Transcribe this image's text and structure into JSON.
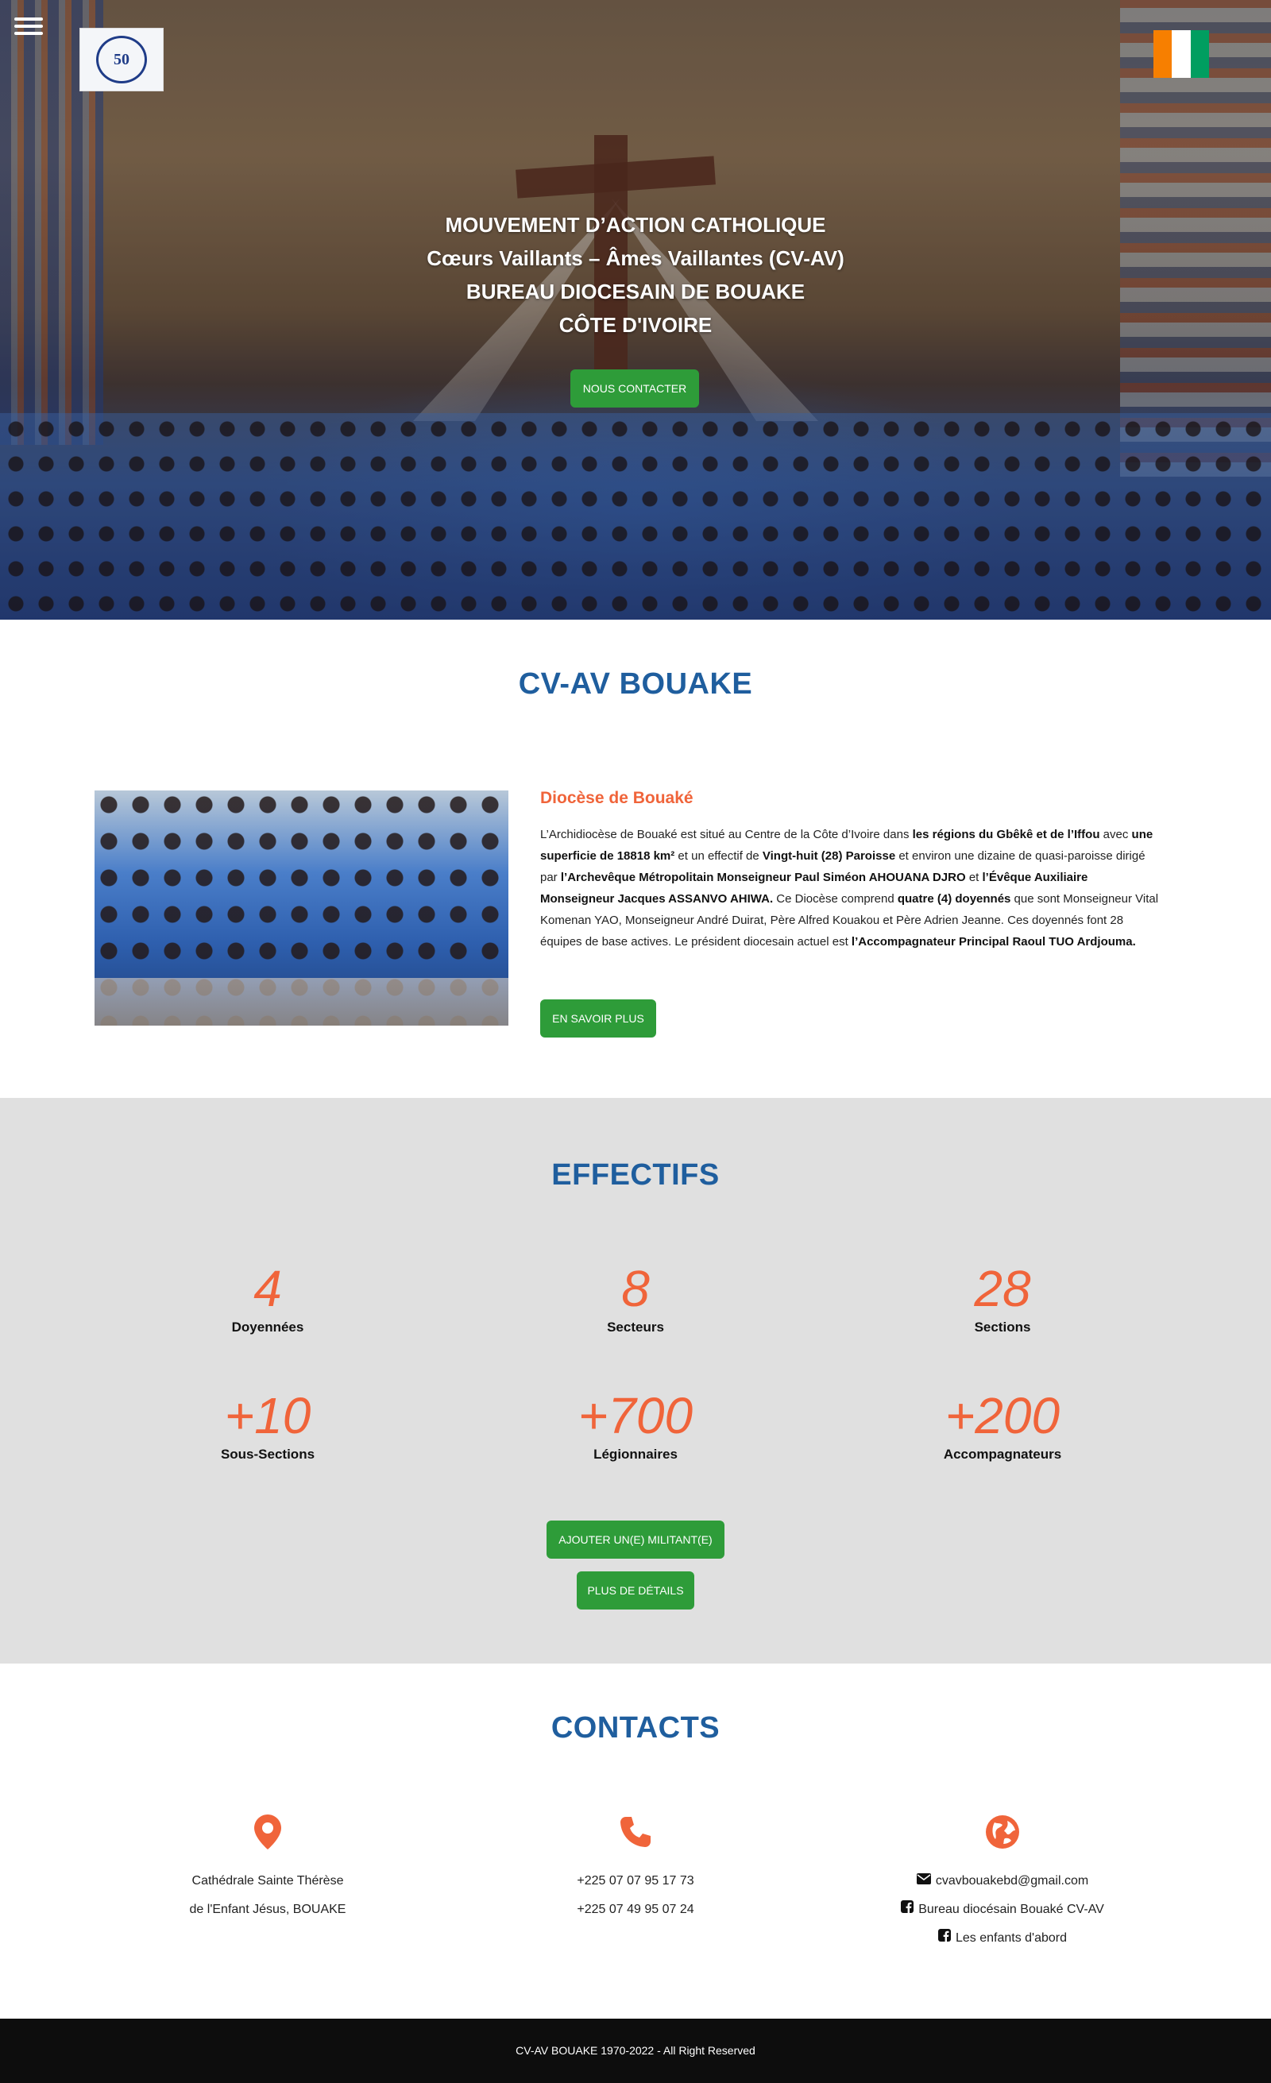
{
  "hero": {
    "menu_icon": "hamburger-menu-icon",
    "logo_left_text": "50",
    "line1": "MOUVEMENT D’ACTION CATHOLIQUE",
    "line2": "Cœurs Vaillants – Âmes Vaillantes (CV-AV)",
    "line3": "BUREAU DIOCESAIN DE BOUAKE",
    "line4": "CÔTE D'IVOIRE",
    "contact_button": "NOUS CONTACTER"
  },
  "about": {
    "title": "CV-AV BOUAKE",
    "subtitle": "Diocèse de Bouaké",
    "p_parts": [
      "L’Archidiocèse de Bouaké est situé au Centre de la Côte d’Ivoire dans ",
      "les régions du Gbêkê et de l’Iffou",
      " avec ",
      "une superficie de 18818 km²",
      " et un effectif de ",
      "Vingt-huit (28) Paroisse",
      " et environ une dizaine de quasi-paroisse dirigé par ",
      "l’Archevêque Métropolitain Monseigneur Paul Siméon AHOUANA DJRO",
      " et ",
      "l’Évêque Auxiliaire Monseigneur Jacques ASSANVO AHIWA.",
      " Ce Diocèse comprend ",
      "quatre (4) doyennés",
      " que sont Monseigneur Vital Komenan YAO, Monseigneur André Duirat, Père Alfred Kouakou et Père Adrien Jeanne. Ces doyennés font 28 équipes de base actives. Le président diocesain actuel est ",
      "l’Accompagnateur Principal Raoul TUO Ardjouma."
    ],
    "more_button": "EN SAVOIR PLUS"
  },
  "effectifs": {
    "title": "EFFECTIFS",
    "stats": [
      {
        "num": "4",
        "label": "Doyennées"
      },
      {
        "num": "8",
        "label": "Secteurs"
      },
      {
        "num": "28",
        "label": "Sections"
      },
      {
        "num": "+10",
        "label": "Sous-Sections"
      },
      {
        "num": "+700",
        "label": "Légionnaires"
      },
      {
        "num": "+200",
        "label": "Accompagnateurs"
      }
    ],
    "add_button": "AJOUTER UN(E) MILITANT(E)",
    "details_button": "PLUS DE DÉTAILS"
  },
  "contacts": {
    "title": "CONTACTS",
    "address_line1": "Cathédrale Sainte Thérèse",
    "address_line2": "de l'Enfant Jésus, BOUAKE",
    "phone1": "+225 07 07 95 17 73",
    "phone2": "+225 07 49 95 07 24",
    "email": "cvavbouakebd@gmail.com",
    "facebook1": "Bureau diocésain Bouaké CV-AV",
    "facebook2": "Les enfants d'abord",
    "accent_color": "#f0643a"
  },
  "footer": {
    "text": "CV-AV BOUAKE 1970-2022 - All Right Reserved"
  }
}
